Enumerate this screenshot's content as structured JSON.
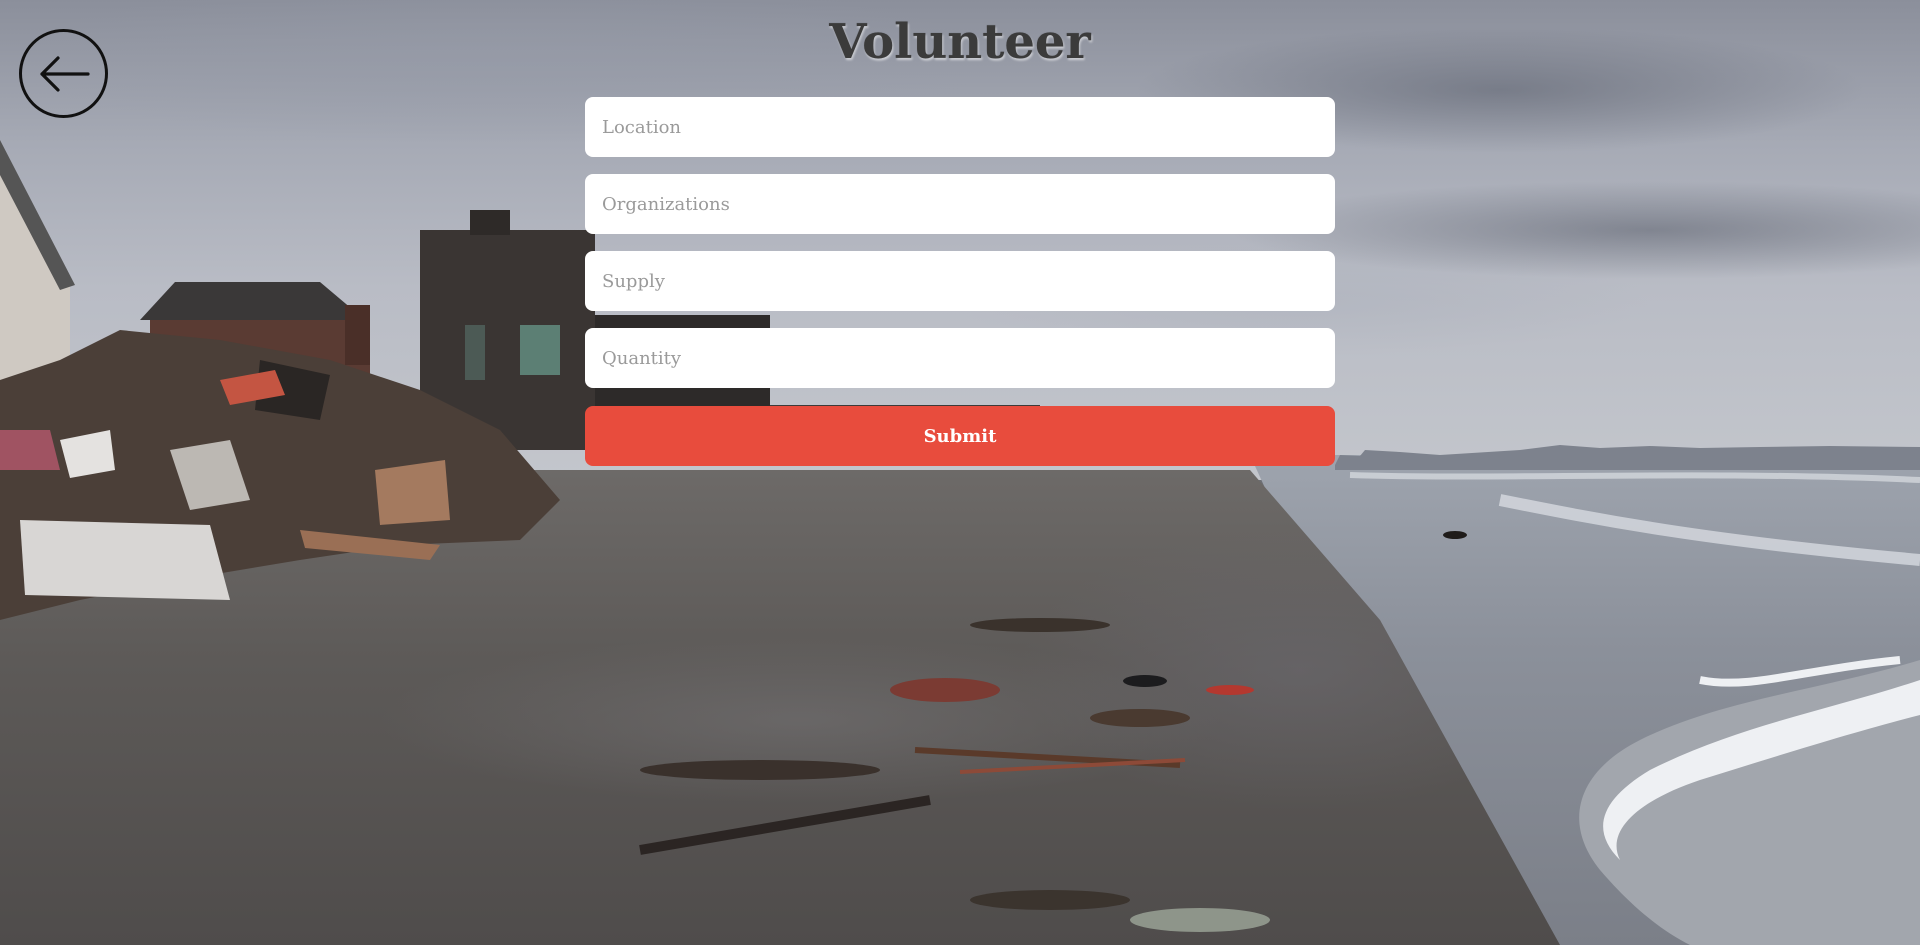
{
  "page": {
    "title": "Volunteer"
  },
  "header": {
    "back_icon": "arrow-left-icon"
  },
  "form": {
    "location_placeholder": "Location",
    "organizations_placeholder": "Organizations",
    "supply_placeholder": "Supply",
    "quantity_placeholder": "Quantity",
    "location_value": "",
    "organizations_value": "",
    "supply_value": "",
    "quantity_value": "",
    "submit_label": "Submit"
  },
  "colors": {
    "submit_background": "#e84c3d",
    "title_text": "#3b3b3b",
    "field_background": "#ffffff"
  }
}
